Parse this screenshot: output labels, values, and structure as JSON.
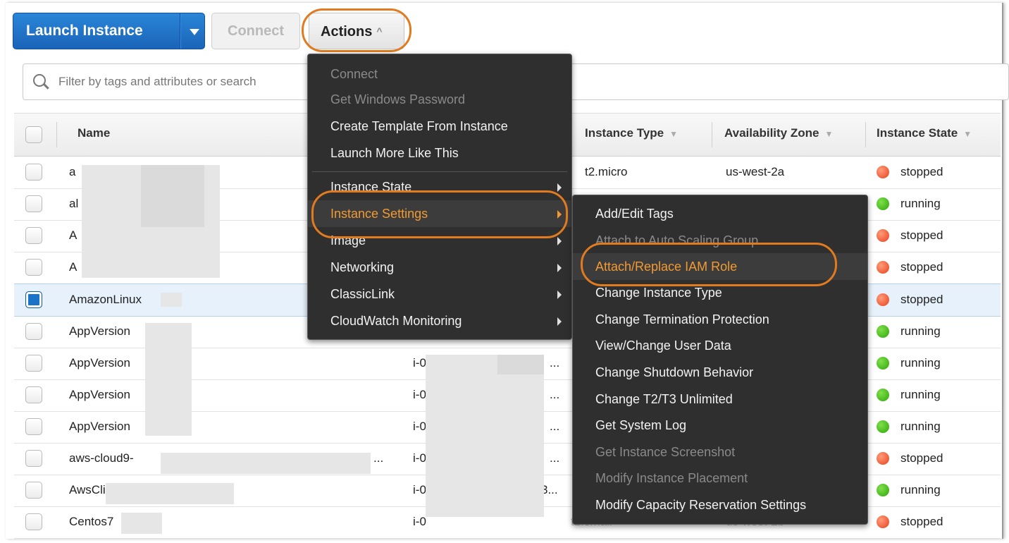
{
  "toolbar": {
    "launch_label": "Launch Instance",
    "connect_label": "Connect",
    "actions_label": "Actions"
  },
  "search": {
    "placeholder": "Filter by tags and attributes or search"
  },
  "table": {
    "headers": {
      "name": "Name",
      "instance_type": "Instance Type",
      "availability_zone": "Availability Zone",
      "instance_state": "Instance State"
    },
    "rows": [
      {
        "name": "a",
        "id": "",
        "type": "t2.micro",
        "zone": "us-west-2a",
        "state": "stopped"
      },
      {
        "name": "al",
        "id": "",
        "type": "",
        "zone": "",
        "state": "running"
      },
      {
        "name": "A",
        "id": "",
        "type": "",
        "zone": "",
        "state": "stopped"
      },
      {
        "name": "A",
        "id": "",
        "type": "",
        "zone": "",
        "state": "stopped"
      },
      {
        "name": "AmazonLinux",
        "id": "",
        "type": "",
        "zone": "",
        "state": "stopped"
      },
      {
        "name": "AppVersion",
        "id": "",
        "type": "",
        "zone": "",
        "state": "running"
      },
      {
        "name": "AppVersion",
        "id": "i-0",
        "type": "",
        "zone": "",
        "state": "running"
      },
      {
        "name": "AppVersion",
        "id": "i-0",
        "type": "",
        "zone": "",
        "state": "running"
      },
      {
        "name": "AppVersion",
        "id": "i-0",
        "type": "",
        "zone": "",
        "state": "running"
      },
      {
        "name": "aws-cloud9-",
        "id": "i-0",
        "type": "",
        "zone": "",
        "state": "stopped"
      },
      {
        "name": "AwsCli",
        "id": "i-0",
        "type": "",
        "zone": "",
        "state": "running"
      },
      {
        "name": "Centos7",
        "id": "i-0",
        "type": "t2.small",
        "zone": "us-west-2b",
        "state": "stopped"
      }
    ]
  },
  "actions_menu": [
    {
      "label": "Connect",
      "disabled": true
    },
    {
      "label": "Get Windows Password",
      "disabled": true
    },
    {
      "label": "Create Template From Instance"
    },
    {
      "label": "Launch More Like This"
    },
    {
      "label": "Instance State"
    },
    {
      "label": "Instance Settings",
      "highlighted": true
    },
    {
      "label": "Image"
    },
    {
      "label": "Networking"
    },
    {
      "label": "ClassicLink"
    },
    {
      "label": "CloudWatch Monitoring"
    }
  ],
  "settings_menu": [
    {
      "label": "Add/Edit Tags"
    },
    {
      "label": "Attach to Auto Scaling Group",
      "disabled": true
    },
    {
      "label": "Attach/Replace IAM Role",
      "highlighted": true
    },
    {
      "label": "Change Instance Type"
    },
    {
      "label": "Change Termination Protection"
    },
    {
      "label": "View/Change User Data"
    },
    {
      "label": "Change Shutdown Behavior"
    },
    {
      "label": "Change T2/T3 Unlimited"
    },
    {
      "label": "Get System Log"
    },
    {
      "label": "Get Instance Screenshot",
      "disabled": true
    },
    {
      "label": "Modify Instance Placement",
      "disabled": true
    },
    {
      "label": "Modify Capacity Reservation Settings"
    }
  ],
  "ellipsis": "...",
  "ellipsis_partial": "3...",
  "colors": {
    "accent": "#1a6fc4",
    "highlight": "#f29a32",
    "annotation": "#e07b1f",
    "stopped": "#e8401c",
    "running": "#2fa50a"
  },
  "icons": {
    "search": "magnifier-icon",
    "dropdown": "caret-down-icon",
    "submenu": "triangle-right-icon"
  }
}
